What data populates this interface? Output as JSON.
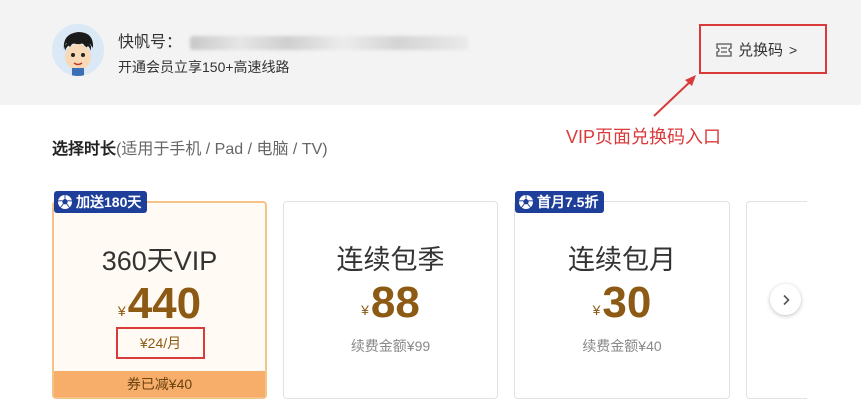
{
  "header": {
    "account_label": "快帆号：",
    "vip_promo": "开通会员立享150+高速线路",
    "redeem": {
      "label": "兑换码",
      "chevron": ">",
      "icon": "ticket-icon"
    }
  },
  "annotation": {
    "text": "VIP页面兑换码入口",
    "color": "#d93a3a"
  },
  "duration": {
    "label": "选择时长",
    "hint": "(适用于手机 / Pad / 电脑 / TV)"
  },
  "plans": [
    {
      "name": "360天VIP",
      "currency": "¥",
      "price": "440",
      "badge": "加送180天",
      "per_month": "¥24/月",
      "coupon": "券已减¥40",
      "selected": true
    },
    {
      "name": "连续包季",
      "currency": "¥",
      "price": "88",
      "renewal": "续费金额¥99",
      "selected": false
    },
    {
      "name": "连续包月",
      "currency": "¥",
      "price": "30",
      "badge": "首月7.5折",
      "renewal": "续费金额¥40",
      "selected": false
    }
  ],
  "colors": {
    "accent_red": "#d93a3a",
    "price_brown": "#8c5a14",
    "badge_blue": "#1d3f9a",
    "coupon_orange": "#f6ae6a",
    "selected_border": "#f5c387"
  }
}
